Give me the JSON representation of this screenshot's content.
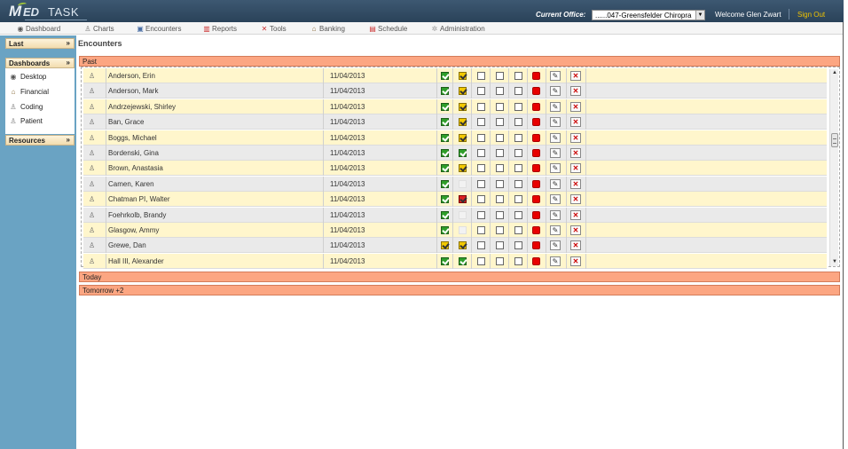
{
  "header": {
    "logo_m": "M",
    "logo_ed": "ED",
    "logo_task": "TASK",
    "office_label": "Current Office:",
    "office_value": "......047-Greensfelder Chiropra",
    "welcome": "Welcome Glen Zwart",
    "signout": "Sign Out"
  },
  "nav": [
    {
      "label": "Dashboard",
      "icon": "dashboard-icon"
    },
    {
      "label": "Charts",
      "icon": "charts-icon"
    },
    {
      "label": "Encounters",
      "icon": "encounters-icon"
    },
    {
      "label": "Reports",
      "icon": "reports-icon"
    },
    {
      "label": "Tools",
      "icon": "tools-icon"
    },
    {
      "label": "Banking",
      "icon": "banking-icon"
    },
    {
      "label": "Schedule",
      "icon": "schedule-icon"
    },
    {
      "label": "Administration",
      "icon": "administration-icon"
    }
  ],
  "sidebar": {
    "last": "Last",
    "dashboards": "Dashboards",
    "resources": "Resources",
    "collapse_glyph": "»",
    "items": [
      {
        "label": "Desktop",
        "icon": "desktop-icon"
      },
      {
        "label": "Financial",
        "icon": "financial-icon"
      },
      {
        "label": "Coding",
        "icon": "coding-icon"
      },
      {
        "label": "Patient",
        "icon": "patient-icon"
      }
    ]
  },
  "main": {
    "title": "Encounters",
    "groups": {
      "past": "Past",
      "today": "Today",
      "tomorrow": "Tomorrow +2"
    },
    "rows": [
      {
        "name": "Anderson, Erin",
        "date": "11/04/2013",
        "c1": "green",
        "c2": "yellow"
      },
      {
        "name": "Anderson, Mark",
        "date": "11/04/2013",
        "c1": "green",
        "c2": "yellow"
      },
      {
        "name": "Andrzejewski, Shirley",
        "date": "11/04/2013",
        "c1": "green",
        "c2": "yellow"
      },
      {
        "name": "Ban, Grace",
        "date": "11/04/2013",
        "c1": "green",
        "c2": "yellow"
      },
      {
        "name": "Boggs, Michael",
        "date": "11/04/2013",
        "c1": "green",
        "c2": "yellow"
      },
      {
        "name": "Bordenski, Gina",
        "date": "11/04/2013",
        "c1": "green",
        "c2": "green"
      },
      {
        "name": "Brown, Anastasia",
        "date": "11/04/2013",
        "c1": "green",
        "c2": "yellow"
      },
      {
        "name": "Camen, Karen",
        "date": "11/04/2013",
        "c1": "green",
        "c2": "blank"
      },
      {
        "name": "Chatman PI, Walter",
        "date": "11/04/2013",
        "c1": "green",
        "c2": "red"
      },
      {
        "name": "Foehrkolb, Brandy",
        "date": "11/04/2013",
        "c1": "green",
        "c2": "blank"
      },
      {
        "name": "Glasgow, Ammy",
        "date": "11/04/2013",
        "c1": "green",
        "c2": "blank"
      },
      {
        "name": "Grewe, Dan",
        "date": "11/04/2013",
        "c1": "yellow",
        "c2": "yellow"
      },
      {
        "name": "Hall III, Alexander",
        "date": "11/04/2013",
        "c1": "green",
        "c2": "green"
      }
    ]
  }
}
